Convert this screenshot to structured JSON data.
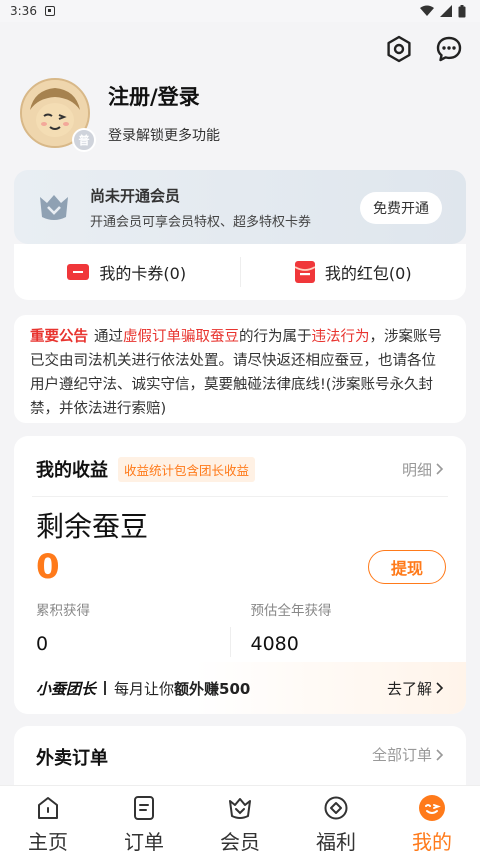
{
  "status_bar": {
    "time": "3:36"
  },
  "profile": {
    "title": "注册/登录",
    "subtitle": "登录解锁更多功能",
    "badge": "普"
  },
  "vip": {
    "title": "尚未开通会员",
    "subtitle": "开通会员可享会员特权、超多特权卡券",
    "button": "免费开通"
  },
  "coupons": [
    {
      "label": "我的卡券(0)"
    },
    {
      "label": "我的红包(0)"
    }
  ],
  "notice": {
    "title": "重要公告",
    "t1": "通过",
    "h1": "虚假订单骗取蚕豆",
    "t2": "的行为属于",
    "h2": "违法行为",
    "t3": "，涉案账号已交由司法机关进行依法处置。请尽快返还相应蚕豆，也请各位用户遵纪守法、诚实守信，莫要触碰法律底线!(涉案账号永久封禁，并依法进行索赔)"
  },
  "income": {
    "title": "我的收益",
    "tag": "收益统计包含团长收益",
    "more": "明细",
    "bean_label": "剩余蚕豆",
    "bean_value": "0",
    "withdraw": "提现",
    "accumulated_label": "累积获得",
    "accumulated_value": "0",
    "estimate_label": "预估全年获得",
    "estimate_value": "4080",
    "leader_brand": "小蚕团长",
    "leader_text_prefix": "每月让你",
    "leader_text_bold": "额外赚500",
    "leader_go": "去了解"
  },
  "orders": {
    "title": "外卖订单",
    "all": "全部订单"
  },
  "tabs": [
    {
      "label": "主页"
    },
    {
      "label": "订单"
    },
    {
      "label": "会员"
    },
    {
      "label": "福利"
    },
    {
      "label": "我的"
    }
  ],
  "colors": {
    "accent": "#ff7a1a",
    "notice_red": "#e8342f"
  }
}
